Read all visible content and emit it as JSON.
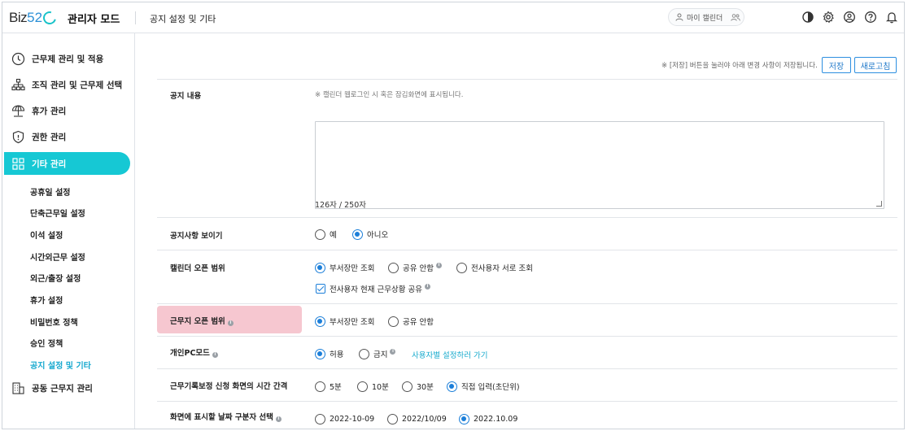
{
  "header": {
    "logo_biz": "Biz",
    "logo_num": "52",
    "admin_title": "관리자 모드",
    "page_title": "공지 설정 및 기타",
    "my_calendar": "마이 캘린더"
  },
  "sidebar": {
    "items": [
      {
        "label": "근무제 관리 및 적용",
        "icon": "clock-icon"
      },
      {
        "label": "조직 관리 및 근무제 선택",
        "icon": "org-chart-icon"
      },
      {
        "label": "휴가 관리",
        "icon": "umbrella-icon"
      },
      {
        "label": "권한 관리",
        "icon": "shield-icon"
      },
      {
        "label": "기타 관리",
        "icon": "grid-icon"
      },
      {
        "label": "공동 근무지 관리",
        "icon": "building-icon"
      }
    ],
    "active_item": "기타 관리",
    "sub_items": [
      "공휴일 설정",
      "단축근무일 설정",
      "이석 설정",
      "시간외근무 설정",
      "외근/출장 설정",
      "휴가 설정",
      "비밀번호 정책",
      "승인 정책",
      "공지 설정 및 기타"
    ],
    "active_sub": "공지 설정 및 기타"
  },
  "toolbar": {
    "note": "※ [저장] 버튼을 눌러야 아래 변경 사항이 저장됩니다.",
    "save_label": "저장",
    "refresh_label": "새로고침"
  },
  "notice": {
    "label": "공지 내용",
    "hint": "※ 캘린더 웹로그인 시 혹은 잠김화면에 표시됩니다.",
    "value": "",
    "counter": "126자 / 250자"
  },
  "show_notice": {
    "label": "공지사항 보이기",
    "options": [
      "예",
      "아니오"
    ],
    "selected": "아니오"
  },
  "calendar_scope": {
    "label": "캘린더 오픈 범위",
    "options": [
      "부서장만 조회",
      "공유 안함",
      "전사용자 서로 조회"
    ],
    "selected": "부서장만 조회",
    "checkbox_label": "전사용자 현재 근무상황 공유",
    "checkbox_checked": true
  },
  "workplace_scope": {
    "label": "근무지 오픈 범위",
    "options": [
      "부서장만 조회",
      "공유 안함"
    ],
    "selected": "부서장만 조회"
  },
  "personal_pc": {
    "label": "개인PC모드",
    "options": [
      "허용",
      "금지"
    ],
    "selected": "허용",
    "link": "사용자별 설정하러 가기"
  },
  "correction_interval": {
    "label": "근무기록보정 신청 화면의 시간 간격",
    "options": [
      "5분",
      "10분",
      "30분",
      "직접 입력(초단위)"
    ],
    "selected": "직접 입력(초단위)"
  },
  "date_format": {
    "label": "화면에 표시할 날짜 구분자 선택",
    "options": [
      "2022-10-09",
      "2022/10/09",
      "2022.10.09"
    ],
    "selected": "2022.10.09"
  },
  "colors": {
    "accent": "#16c8d4",
    "primary_blue": "#1c7fd9",
    "highlight_pink": "#f6c7d0",
    "link": "#16aacd"
  }
}
